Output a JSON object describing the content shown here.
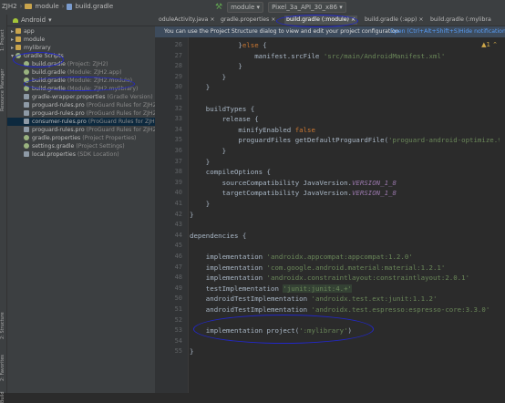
{
  "breadcrumbs": [
    "ZJH2",
    "module",
    "build.gradle"
  ],
  "toolbar": {
    "module_combo": "module",
    "device_combo": "Pixel_3a_API_30_x86"
  },
  "sidebar": {
    "labels": [
      "1: Project",
      "Resource Manager",
      "2: Structure",
      "2: Favorites",
      "Build"
    ]
  },
  "project": {
    "view_mode": "Android",
    "rows": [
      {
        "label": "app",
        "hint": "",
        "icon": "folder",
        "arrow": "▸",
        "indent": 1
      },
      {
        "label": "module",
        "hint": "",
        "icon": "folder",
        "arrow": "▸",
        "indent": 1
      },
      {
        "label": "mylibrary",
        "hint": "",
        "icon": "folder",
        "arrow": "▸",
        "indent": 1
      },
      {
        "label": "Gradle Scripts",
        "hint": "",
        "icon": "gradle",
        "arrow": "▾",
        "indent": 1
      },
      {
        "label": "build.gradle",
        "hint": "(Project: ZJH2)",
        "icon": "gradle",
        "arrow": "",
        "indent": 2
      },
      {
        "label": "build.gradle",
        "hint": "(Module: ZJH2.app)",
        "icon": "gradle",
        "arrow": "",
        "indent": 2
      },
      {
        "label": "build.gradle",
        "hint": "(Module: ZJH2.module)",
        "icon": "gradle",
        "arrow": "",
        "indent": 2
      },
      {
        "label": "build.gradle",
        "hint": "(Module: ZJH2.mylibrary)",
        "icon": "gradle",
        "arrow": "",
        "indent": 2
      },
      {
        "label": "gradle-wrapper.properties",
        "hint": "(Gradle Version)",
        "icon": "file",
        "arrow": "",
        "indent": 2
      },
      {
        "label": "proguard-rules.pro",
        "hint": "(ProGuard Rules for ZJH2.app)",
        "icon": "file",
        "arrow": "",
        "indent": 2
      },
      {
        "label": "proguard-rules.pro",
        "hint": "(ProGuard Rules for ZJH2.mo",
        "icon": "file",
        "arrow": "",
        "indent": 2
      },
      {
        "label": "consumer-rules.pro",
        "hint": "(ProGuard Rules for ZJH2.my",
        "icon": "file",
        "arrow": "",
        "indent": 2,
        "selected": true
      },
      {
        "label": "proguard-rules.pro",
        "hint": "(ProGuard Rules for ZJH2.my",
        "icon": "file",
        "arrow": "",
        "indent": 2
      },
      {
        "label": "gradle.properties",
        "hint": "(Project Properties)",
        "icon": "gradle",
        "arrow": "",
        "indent": 2
      },
      {
        "label": "settings.gradle",
        "hint": "(Project Settings)",
        "icon": "gradle",
        "arrow": "",
        "indent": 2
      },
      {
        "label": "local.properties",
        "hint": "(SDK Location)",
        "icon": "file",
        "arrow": "",
        "indent": 2
      }
    ]
  },
  "tabs": [
    {
      "label": "oduleActivity.java",
      "active": false
    },
    {
      "label": "gradle.properties",
      "active": false
    },
    {
      "label": "build.gradle (:module)",
      "active": true
    },
    {
      "label": "build.gradle (:app)",
      "active": false
    },
    {
      "label": "build.gradle (:mylibra",
      "active": false
    }
  ],
  "notification": {
    "text": "You can use the Project Structure dialog to view and edit your project configuration",
    "open_link": "Open (Ctrl+Alt+Shift+S)",
    "hide_link": "Hide notification"
  },
  "editor": {
    "lines": [
      {
        "n": "26",
        "code": [
          [
            "            }",
            ""
          ],
          [
            "else",
            "kw"
          ],
          [
            " {",
            ""
          ]
        ]
      },
      {
        "n": "27",
        "code": [
          [
            "                manifest.srcFile ",
            ""
          ],
          [
            "'src/main/AndroidManifest.xml'",
            "str"
          ]
        ]
      },
      {
        "n": "28",
        "code": [
          [
            "            }",
            ""
          ]
        ]
      },
      {
        "n": "29",
        "code": [
          [
            "        }",
            ""
          ]
        ]
      },
      {
        "n": "30",
        "code": [
          [
            "    }",
            ""
          ]
        ]
      },
      {
        "n": "31",
        "code": [
          [
            "",
            ""
          ]
        ]
      },
      {
        "n": "32",
        "code": [
          [
            "    buildTypes {",
            ""
          ]
        ]
      },
      {
        "n": "33",
        "code": [
          [
            "        release {",
            ""
          ]
        ]
      },
      {
        "n": "34",
        "code": [
          [
            "            minifyEnabled ",
            ""
          ],
          [
            "false",
            "kw"
          ]
        ]
      },
      {
        "n": "35",
        "code": [
          [
            "            proguardFiles getDefaultProguardFile(",
            ""
          ],
          [
            "'proguard-android-optimize.txt'",
            "str"
          ]
        ]
      },
      {
        "n": "36",
        "code": [
          [
            "        }",
            ""
          ]
        ]
      },
      {
        "n": "37",
        "code": [
          [
            "    }",
            ""
          ]
        ]
      },
      {
        "n": "38",
        "code": [
          [
            "    compileOptions {",
            ""
          ]
        ]
      },
      {
        "n": "39",
        "code": [
          [
            "        sourceCompatibility JavaVersion.",
            ""
          ],
          [
            "VERSION_1_8",
            "konst"
          ]
        ]
      },
      {
        "n": "40",
        "code": [
          [
            "        targetCompatibility JavaVersion.",
            ""
          ],
          [
            "VERSION_1_8",
            "konst"
          ]
        ]
      },
      {
        "n": "41",
        "code": [
          [
            "    }",
            ""
          ]
        ]
      },
      {
        "n": "42",
        "code": [
          [
            "}",
            ""
          ]
        ]
      },
      {
        "n": "43",
        "code": [
          [
            "",
            ""
          ]
        ]
      },
      {
        "n": "44",
        "code": [
          [
            "dependencies {",
            ""
          ]
        ]
      },
      {
        "n": "45",
        "code": [
          [
            "",
            ""
          ]
        ]
      },
      {
        "n": "46",
        "code": [
          [
            "    implementation ",
            ""
          ],
          [
            "'androidx.appcompat:appcompat:1.2.0'",
            "str"
          ]
        ]
      },
      {
        "n": "47",
        "code": [
          [
            "    implementation ",
            ""
          ],
          [
            "'com.google.android.material:material:1.2.1'",
            "str"
          ]
        ]
      },
      {
        "n": "48",
        "code": [
          [
            "    implementation ",
            ""
          ],
          [
            "'androidx.constraintlayout:constraintlayout:2.0.1'",
            "str"
          ]
        ]
      },
      {
        "n": "49",
        "code": [
          [
            "    testImplementation ",
            ""
          ],
          [
            "'junit:junit:4.+'",
            "str hl"
          ]
        ]
      },
      {
        "n": "50",
        "code": [
          [
            "    androidTestImplementation ",
            ""
          ],
          [
            "'androidx.test.ext:junit:1.1.2'",
            "str"
          ]
        ]
      },
      {
        "n": "51",
        "code": [
          [
            "    androidTestImplementation ",
            ""
          ],
          [
            "'androidx.test.espresso:espresso-core:3.3.0'",
            "str"
          ]
        ]
      },
      {
        "n": "52",
        "code": [
          [
            "",
            ""
          ]
        ]
      },
      {
        "n": "53",
        "code": [
          [
            "    implementation project(",
            ""
          ],
          [
            "':mylibrary'",
            "str"
          ],
          [
            ")",
            ""
          ]
        ]
      },
      {
        "n": "54",
        "code": [
          [
            "",
            ""
          ]
        ]
      },
      {
        "n": "55",
        "code": [
          [
            "}",
            ""
          ]
        ]
      }
    ]
  },
  "colors": {
    "annotation": "#2227c8",
    "selection": "#0d293e",
    "keyword": "#cc7832",
    "string": "#6a8759"
  }
}
